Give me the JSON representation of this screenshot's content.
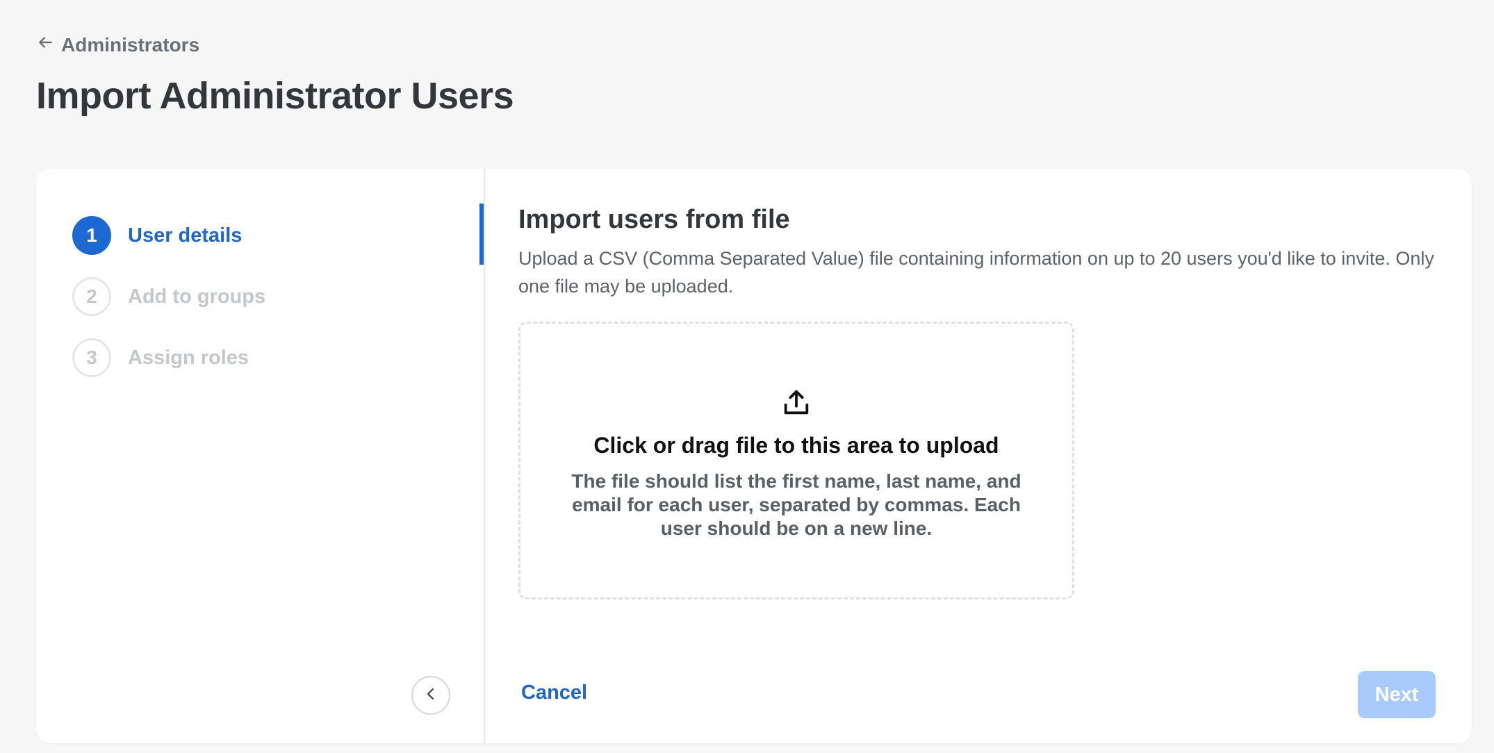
{
  "header": {
    "back_label": "Administrators",
    "title": "Import Administrator Users"
  },
  "steps": [
    {
      "number": "1",
      "label": "User details",
      "active": true
    },
    {
      "number": "2",
      "label": "Add to groups",
      "active": false
    },
    {
      "number": "3",
      "label": "Assign roles",
      "active": false
    }
  ],
  "main": {
    "title": "Import users from file",
    "description": "Upload a CSV (Comma Separated Value) file containing information on up to 20 users you'd like to invite. Only one file may be uploaded.",
    "dropzone": {
      "title": "Click or drag file to this area to upload",
      "help": "The file should list the first name, last name, and email for each user, separated by commas. Each user should be on a new line."
    }
  },
  "footer": {
    "cancel_label": "Cancel",
    "next_label": "Next"
  },
  "icons": {
    "back": "arrow-left-icon",
    "collapse": "chevron-left-icon",
    "upload": "upload-icon"
  },
  "colors": {
    "accent": "#1d69d3",
    "next_disabled": "#a9cbfb"
  }
}
